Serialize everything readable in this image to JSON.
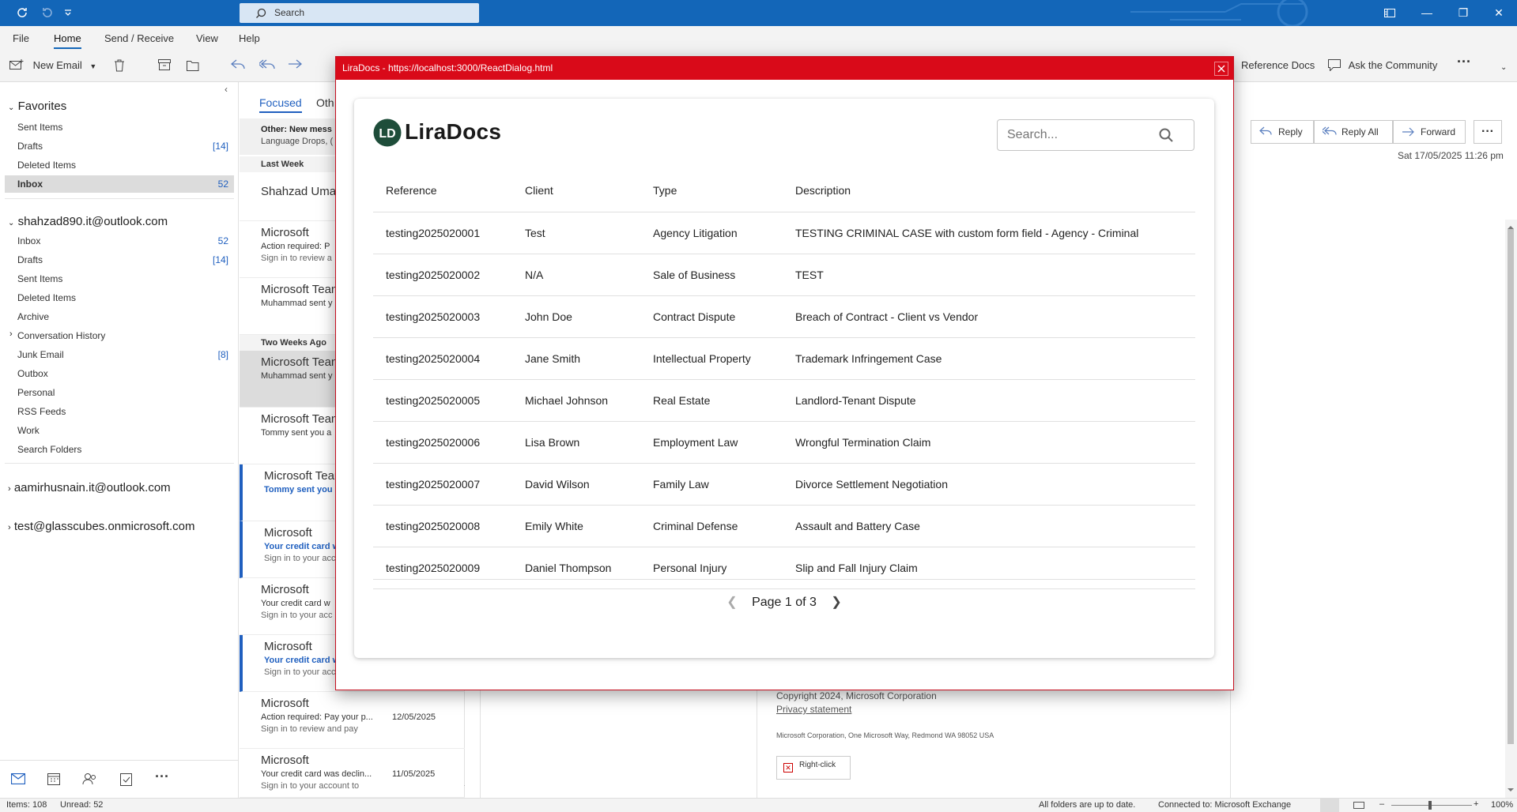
{
  "titlebar": {
    "search_placeholder": "Search"
  },
  "menu": [
    "File",
    "Home",
    "Send / Receive",
    "View",
    "Help"
  ],
  "ribbon": {
    "new_email": "New Email",
    "reference_docs": "Reference Docs",
    "ask_community": "Ask the Community"
  },
  "favorites": {
    "header": "Favorites",
    "items": [
      {
        "label": "Sent Items",
        "count": ""
      },
      {
        "label": "Drafts",
        "count": "[14]"
      },
      {
        "label": "Deleted Items",
        "count": ""
      },
      {
        "label": "Inbox",
        "count": "52"
      }
    ]
  },
  "accounts": [
    {
      "name": "shahzad890.it@outlook.com",
      "folders": [
        {
          "label": "Inbox",
          "count": "52"
        },
        {
          "label": "Drafts",
          "count": "[14]"
        },
        {
          "label": "Sent Items",
          "count": ""
        },
        {
          "label": "Deleted Items",
          "count": ""
        },
        {
          "label": "Archive",
          "count": ""
        },
        {
          "label": "Conversation History",
          "count": ""
        },
        {
          "label": "Junk Email",
          "count": "[8]"
        },
        {
          "label": "Outbox",
          "count": ""
        },
        {
          "label": "Personal",
          "count": ""
        },
        {
          "label": "RSS Feeds",
          "count": ""
        },
        {
          "label": "Work",
          "count": ""
        },
        {
          "label": "Search Folders",
          "count": ""
        }
      ]
    },
    {
      "name": "aamirhusnain.it@outlook.com"
    },
    {
      "name": "test@glasscubes.onmicrosoft.com"
    }
  ],
  "msglist": {
    "tab_focused": "Focused",
    "tab_other": "Oth",
    "other_banner": "Other: New mess",
    "other_banner_sub": "Language Drops, (",
    "groups": [
      "Last Week",
      "Two Weeks Ago"
    ],
    "messages": [
      {
        "sender": "Shahzad Umar",
        "subject": "",
        "preview": "",
        "date": ""
      },
      {
        "sender": "Microsoft",
        "subject": "Action required: P",
        "preview": "Sign in to review a",
        "date": ""
      },
      {
        "sender": "Microsoft Tean",
        "subject": "Muhammad sent y",
        "preview": "",
        "date": ""
      },
      {
        "sender": "Microsoft Tean",
        "subject": "Muhammad sent y",
        "preview": "",
        "date": ""
      },
      {
        "sender": "Microsoft Tean",
        "subject": "Tommy sent you a",
        "preview": "",
        "date": ""
      },
      {
        "sender": "Microsoft Tean",
        "subject": "Tommy sent you a",
        "preview": "",
        "date": ""
      },
      {
        "sender": "Microsoft",
        "subject": "Your credit card w",
        "preview": "Sign in to your acc",
        "date": ""
      },
      {
        "sender": "Microsoft",
        "subject": "Your credit card w",
        "preview": "Sign in to your acc",
        "date": ""
      },
      {
        "sender": "Microsoft",
        "subject": "Your credit card w",
        "preview": "Sign in to your acc",
        "date": ""
      },
      {
        "sender": "Microsoft",
        "subject": "Action required: Pay your p...",
        "preview": "Sign in to review and pay",
        "date": "12/05/2025"
      },
      {
        "sender": "Microsoft",
        "subject": "Your credit card was declin...",
        "preview": "Sign in to your account to",
        "date": "11/05/2025"
      }
    ]
  },
  "reading": {
    "reply": "Reply",
    "reply_all": "Reply All",
    "forward": "Forward",
    "date": "Sat 17/05/2025 11:26 pm",
    "copyright": "Copyright 2024, Microsoft Corporation",
    "privacy": "Privacy statement",
    "address": "Microsoft Corporation, One Microsoft Way, Redmond WA 98052 USA",
    "image_placeholder": "Right-click"
  },
  "status": {
    "items": "Items: 108",
    "unread": "Unread: 52",
    "folders": "All folders are up to date.",
    "connected": "Connected to: Microsoft Exchange",
    "zoom": "100%"
  },
  "dialog": {
    "title": "LiraDocs - https://localhost:3000/ReactDialog.html",
    "logo_text": "LiraDocs",
    "logo_initials": "LD",
    "search_placeholder": "Search...",
    "columns": [
      "Reference",
      "Client",
      "Type",
      "Description"
    ],
    "rows": [
      [
        "testing2025020001",
        "Test",
        "Agency Litigation",
        "TESTING CRIMINAL CASE with custom form field - Agency - Criminal"
      ],
      [
        "testing2025020002",
        "N/A",
        "Sale of Business",
        "TEST"
      ],
      [
        "testing2025020003",
        "John Doe",
        "Contract Dispute",
        "Breach of Contract - Client vs Vendor"
      ],
      [
        "testing2025020004",
        "Jane Smith",
        "Intellectual Property",
        "Trademark Infringement Case"
      ],
      [
        "testing2025020005",
        "Michael Johnson",
        "Real Estate",
        "Landlord-Tenant Dispute"
      ],
      [
        "testing2025020006",
        "Lisa Brown",
        "Employment Law",
        "Wrongful Termination Claim"
      ],
      [
        "testing2025020007",
        "David Wilson",
        "Family Law",
        "Divorce Settlement Negotiation"
      ],
      [
        "testing2025020008",
        "Emily White",
        "Criminal Defense",
        "Assault and Battery Case"
      ],
      [
        "testing2025020009",
        "Daniel Thompson",
        "Personal Injury",
        "Slip and Fall Injury Claim"
      ]
    ],
    "pager": "Page 1 of 3"
  },
  "colors": {
    "titlebar": "#1366b8",
    "dialog_title": "#d90a19",
    "accent": "#1f5fbf",
    "logo": "#1e4d3a"
  }
}
